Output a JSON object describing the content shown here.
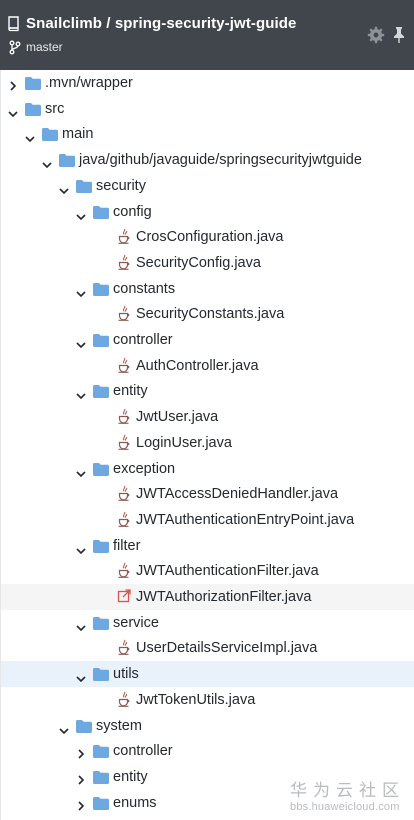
{
  "header": {
    "repo_title": "Snailclimb / spring-security-jwt-guide",
    "branch": "master",
    "icons": {
      "repo": "repo-icon",
      "branch": "branch-icon",
      "settings": "gear-icon",
      "pin": "pin-icon"
    }
  },
  "tree": [
    {
      "label": ".mvn/wrapper",
      "type": "folder",
      "expanded": false,
      "depth": 0
    },
    {
      "label": "src",
      "type": "folder",
      "expanded": true,
      "depth": 0
    },
    {
      "label": "main",
      "type": "folder",
      "expanded": true,
      "depth": 1
    },
    {
      "label": "java/github/javaguide/springsecurityjwtguide",
      "type": "folder",
      "expanded": true,
      "depth": 2
    },
    {
      "label": "security",
      "type": "folder",
      "expanded": true,
      "depth": 3
    },
    {
      "label": "config",
      "type": "folder",
      "expanded": true,
      "depth": 4
    },
    {
      "label": "CrosConfiguration.java",
      "type": "java",
      "depth": 5
    },
    {
      "label": "SecurityConfig.java",
      "type": "java",
      "depth": 5
    },
    {
      "label": "constants",
      "type": "folder",
      "expanded": true,
      "depth": 4
    },
    {
      "label": "SecurityConstants.java",
      "type": "java",
      "depth": 5
    },
    {
      "label": "controller",
      "type": "folder",
      "expanded": true,
      "depth": 4
    },
    {
      "label": "AuthController.java",
      "type": "java",
      "depth": 5
    },
    {
      "label": "entity",
      "type": "folder",
      "expanded": true,
      "depth": 4
    },
    {
      "label": "JwtUser.java",
      "type": "java",
      "depth": 5
    },
    {
      "label": "LoginUser.java",
      "type": "java",
      "depth": 5
    },
    {
      "label": "exception",
      "type": "folder",
      "expanded": true,
      "depth": 4
    },
    {
      "label": "JWTAccessDeniedHandler.java",
      "type": "java",
      "depth": 5
    },
    {
      "label": "JWTAuthenticationEntryPoint.java",
      "type": "java",
      "depth": 5
    },
    {
      "label": "filter",
      "type": "folder",
      "expanded": true,
      "depth": 4
    },
    {
      "label": "JWTAuthenticationFilter.java",
      "type": "java",
      "depth": 5
    },
    {
      "label": "JWTAuthorizationFilter.java",
      "type": "link",
      "depth": 5,
      "selected": true
    },
    {
      "label": "service",
      "type": "folder",
      "expanded": true,
      "depth": 4
    },
    {
      "label": "UserDetailsServiceImpl.java",
      "type": "java",
      "depth": 5
    },
    {
      "label": "utils",
      "type": "folder",
      "expanded": true,
      "depth": 4,
      "hover": true
    },
    {
      "label": "JwtTokenUtils.java",
      "type": "java",
      "depth": 5
    },
    {
      "label": "system",
      "type": "folder",
      "expanded": true,
      "depth": 3
    },
    {
      "label": "controller",
      "type": "folder",
      "expanded": false,
      "depth": 4
    },
    {
      "label": "entity",
      "type": "folder",
      "expanded": false,
      "depth": 4
    },
    {
      "label": "enums",
      "type": "folder",
      "expanded": false,
      "depth": 4
    }
  ],
  "watermark": {
    "cn": "华为云社区",
    "url": "bbs.huaweicloud.com"
  },
  "colors": {
    "header_bg": "#41464c",
    "folder": "#6da8e0",
    "java_icon": "#8c5a4e",
    "link_icon": "#d9534f",
    "selected_row": "#f5f5f5",
    "hover_row": "#e9f1fb"
  }
}
